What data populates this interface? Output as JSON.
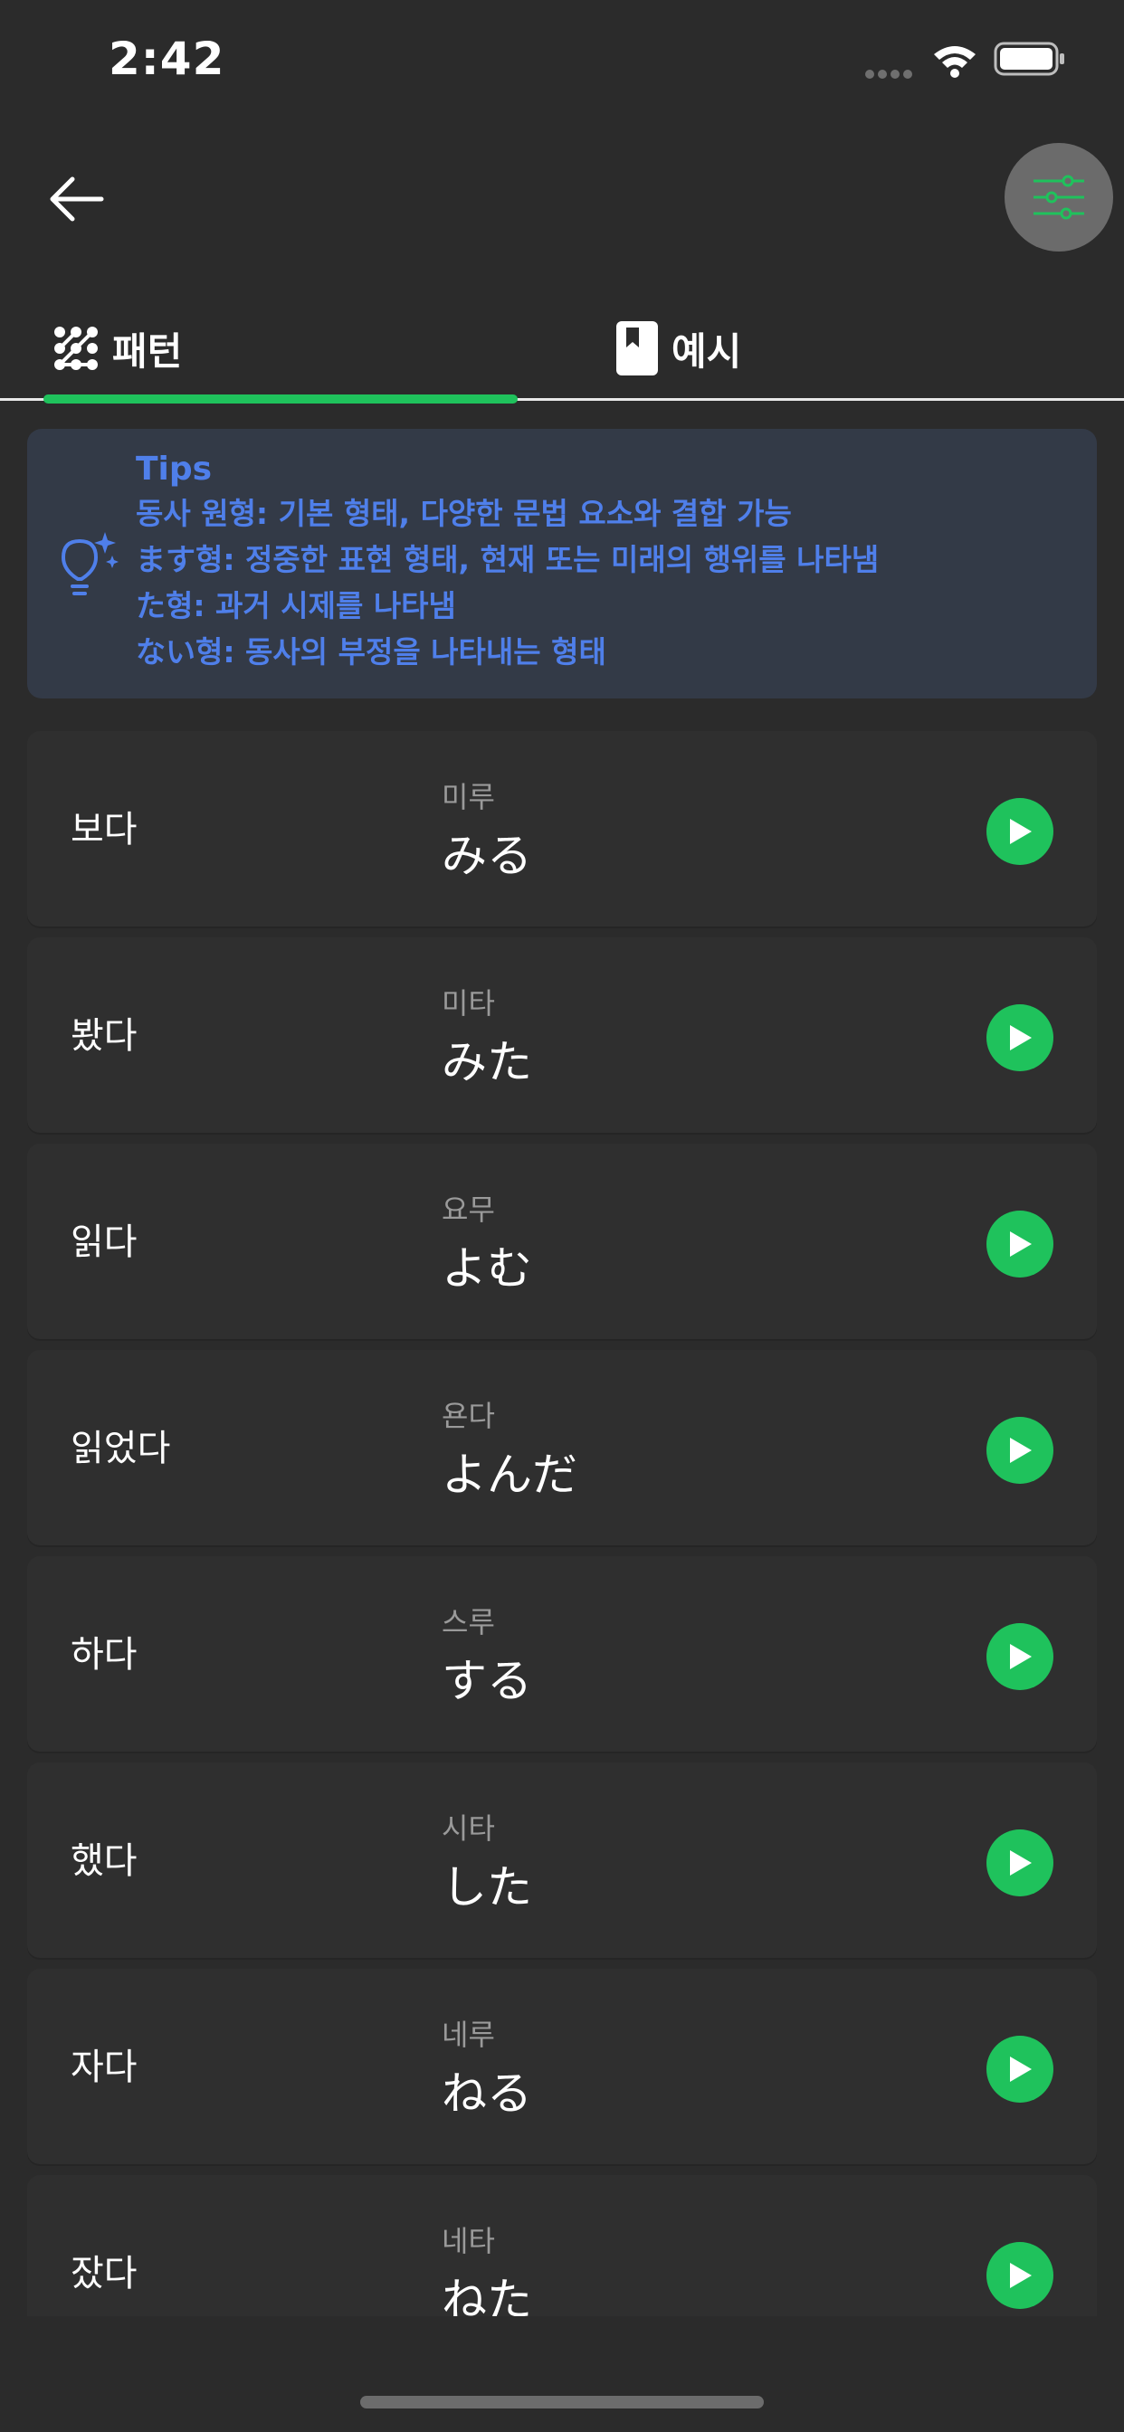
{
  "status_bar": {
    "time": "2:42"
  },
  "tabs": [
    {
      "label": "패턴",
      "icon": "pattern-dots-icon",
      "active": true
    },
    {
      "label": "예시",
      "icon": "bookmark-book-icon",
      "active": false
    }
  ],
  "tips": {
    "title": "Tips",
    "lines": [
      "동사 원형: 기본 형태, 다양한 문법 요소와 결합 가능",
      "ます형: 정중한 표현 형태, 현재 또는 미래의 행위를 나타냄",
      "た형: 과거 시제를 나타냄",
      "ない형: 동사의 부정을 나타내는 형태"
    ]
  },
  "verbs": [
    {
      "korean": "보다",
      "reading": "미루",
      "kana": "みる"
    },
    {
      "korean": "봤다",
      "reading": "미타",
      "kana": "みた"
    },
    {
      "korean": "읽다",
      "reading": "요무",
      "kana": "よむ"
    },
    {
      "korean": "읽었다",
      "reading": "욘다",
      "kana": "よんだ"
    },
    {
      "korean": "하다",
      "reading": "스루",
      "kana": "する"
    },
    {
      "korean": "했다",
      "reading": "시타",
      "kana": "した"
    },
    {
      "korean": "자다",
      "reading": "네루",
      "kana": "ねる"
    },
    {
      "korean": "잤다",
      "reading": "네타",
      "kana": "ねた"
    }
  ],
  "colors": {
    "background": "#2b2b2b",
    "card": "#2f2f2f",
    "accent": "#1fc25c",
    "tips_bg": "#333a47",
    "tips_text": "#4f7fea"
  }
}
